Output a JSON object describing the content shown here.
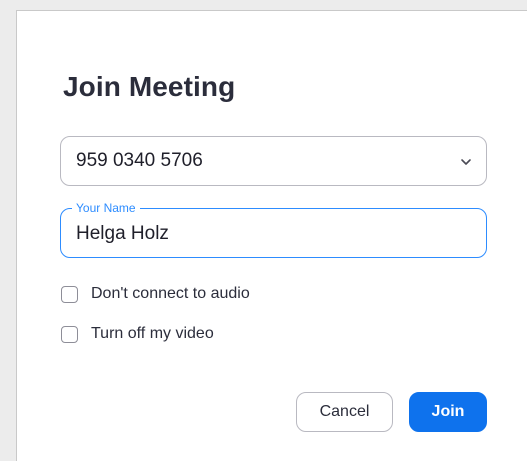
{
  "dialog": {
    "title": "Join Meeting"
  },
  "meeting_id_select": {
    "value": "959 0340 5706",
    "icon": "chevron-down-icon"
  },
  "name_field": {
    "label": "Your Name",
    "value": "Helga Holz"
  },
  "options": [
    {
      "label": "Don't connect to audio",
      "checked": false
    },
    {
      "label": "Turn off my video",
      "checked": false
    }
  ],
  "buttons": {
    "cancel_label": "Cancel",
    "join_label": "Join"
  },
  "colors": {
    "accent": "#2D8CFF",
    "primary_button": "#0E72ED"
  }
}
